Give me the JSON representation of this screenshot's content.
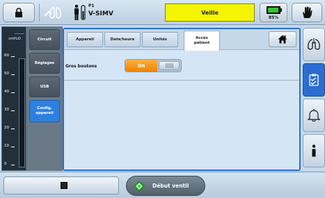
{
  "topbar": {
    "patient_id": "P1",
    "mode": "V-SIMV",
    "status": "Veille",
    "battery": "85%"
  },
  "gauge": {
    "unit": "cmH₂O",
    "ticks": [
      "60",
      "50",
      "40",
      "30",
      "20",
      "10",
      "0"
    ]
  },
  "left_menu": {
    "items": [
      {
        "label": "Circuit"
      },
      {
        "label": "Réglages"
      },
      {
        "label": "USB"
      },
      {
        "label": "Config. appareil"
      }
    ]
  },
  "main": {
    "tabs": [
      {
        "label": "Appareil"
      },
      {
        "label": "Date/heure"
      },
      {
        "label": "Unités"
      },
      {
        "label": "Accès patient"
      }
    ],
    "setting": {
      "label": "Gros boutons",
      "value": "On"
    }
  },
  "bottom": {
    "start_label": "Début ventil"
  },
  "colors": {
    "accent": "#2b6ed0",
    "status_bg": "#f5f500",
    "toggle_on": "#f39200",
    "active_menu": "#2d7fe0"
  },
  "icons": [
    "lock-icon",
    "lungs-icon",
    "patient-icon",
    "battery-icon",
    "hand-icon",
    "home-icon",
    "lungs-outline-icon",
    "checklist-icon",
    "alarm-bell-icon",
    "info-icon",
    "stop-icon",
    "start-ventilation-icon"
  ]
}
